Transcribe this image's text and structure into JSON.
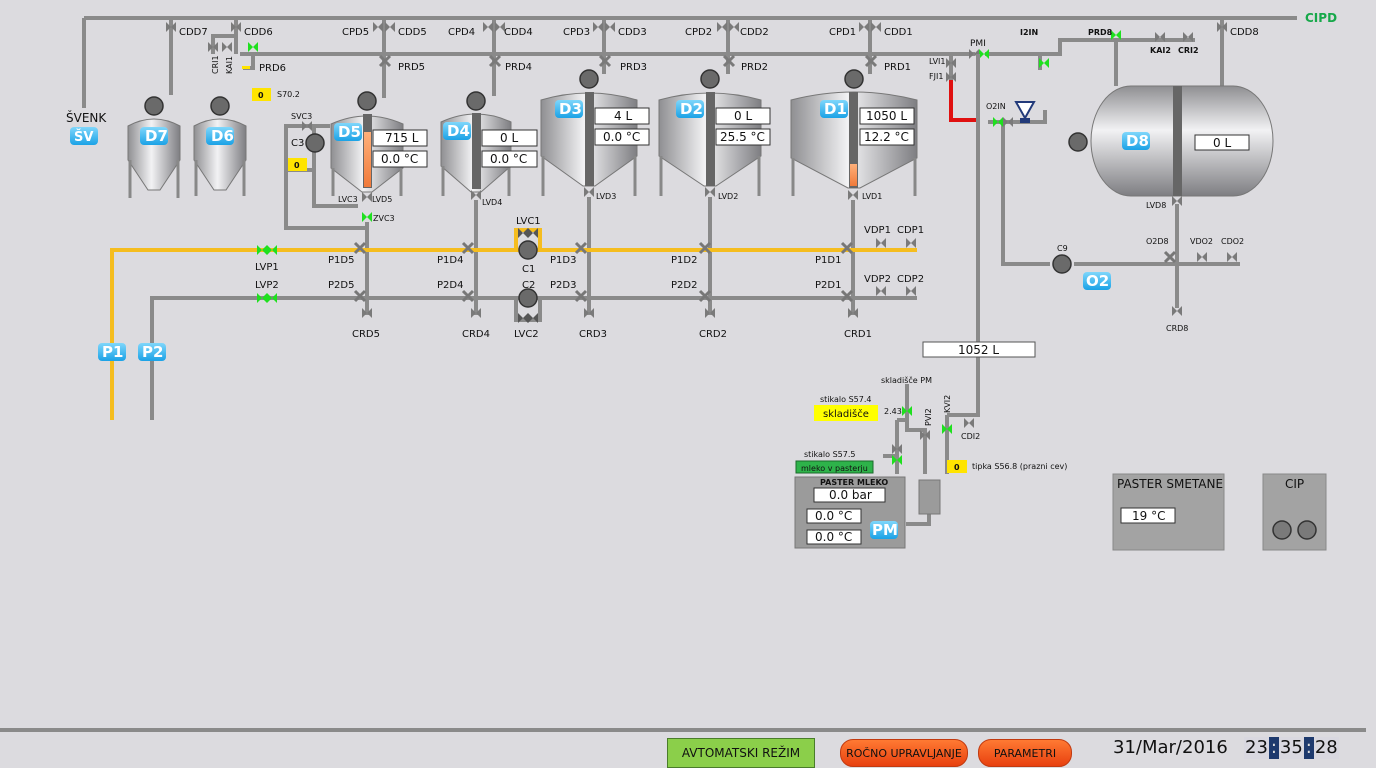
{
  "header": {
    "cipd": "CIPD"
  },
  "tanks": {
    "d7": {
      "tag": "D7",
      "valve_top": "CDD7"
    },
    "d6": {
      "tag": "D6",
      "valve_top": "CDD6"
    },
    "d5": {
      "tag": "D5",
      "volume": "715 L",
      "temp": "0.0 °C",
      "cpd": "CPD5",
      "cdd": "CDD5",
      "prd": "PRD5",
      "lvd": "LVD5"
    },
    "d4": {
      "tag": "D4",
      "volume": "0 L",
      "temp": "0.0 °C",
      "cpd": "CPD4",
      "cdd": "CDD4",
      "prd": "PRD4",
      "lvd": "LVD4"
    },
    "d3": {
      "tag": "D3",
      "volume": "4 L",
      "temp": "0.0 °C",
      "cpd": "CPD3",
      "cdd": "CDD3",
      "prd": "PRD3",
      "lvd": "LVD3"
    },
    "d2": {
      "tag": "D2",
      "volume": "0 L",
      "temp": "25.5 °C",
      "cpd": "CPD2",
      "cdd": "CDD2",
      "prd": "PRD2",
      "lvd": "LVD2"
    },
    "d1": {
      "tag": "D1",
      "volume": "1050 L",
      "temp": "12.2 °C",
      "cpd": "CPD1",
      "cdd": "CDD1",
      "prd": "PRD1",
      "lvd": "LVD1"
    },
    "d8": {
      "tag": "D8",
      "volume": "0 L",
      "lvd": "LVD8",
      "cdd": "CDD8",
      "prd": "PRD8"
    }
  },
  "labels": {
    "svenk": "ŠVENK",
    "sv": "ŠV",
    "cri1": "CRI1",
    "kai1": "KAI1",
    "prd6": "PRD6",
    "s702_val": "0",
    "s702": "S70.2",
    "svc3": "SVC3",
    "c3": "C3",
    "c3_val": "0",
    "lvc3": "LVC3",
    "zvc3": "ZVC3",
    "pmi": "PMI",
    "lvi1": "LVI1",
    "fji1": "FJI1",
    "i2in": "I2IN",
    "o2in": "O2IN",
    "kai2": "KAI2",
    "cri2": "CRI2",
    "lvp1": "LVP1",
    "lvp2": "LVP2",
    "p1": "P1",
    "p2": "P2",
    "lvc1": "LVC1",
    "lvc2": "LVC2",
    "c1": "C1",
    "c2": "C2",
    "p1d5": "P1D5",
    "p2d5": "P2D5",
    "crd5": "CRD5",
    "p1d4": "P1D4",
    "p2d4": "P2D4",
    "crd4": "CRD4",
    "p1d3": "P1D3",
    "p2d3": "P2D3",
    "crd3": "CRD3",
    "p1d2": "P1D2",
    "p2d2": "P2D2",
    "crd2": "CRD2",
    "p1d1": "P1D1",
    "p2d1": "P2D1",
    "crd1": "CRD1",
    "vdp1": "VDP1",
    "cdp1": "CDP1",
    "vdp2": "VDP2",
    "cdp2": "CDP2",
    "c9": "C9",
    "o2": "O2",
    "o2d8": "O2D8",
    "vdo2": "VDO2",
    "cdo2": "CDO2",
    "crd8": "CRD8",
    "flow_total": "1052 L"
  },
  "paster_mleko": {
    "title": "PASTER MLEKO",
    "tag": "PM",
    "pressure": "0.0 bar",
    "temp1": "0.0 °C",
    "temp2": "0.0 °C",
    "skladisce_pm": "skladišče PM",
    "stikalo_574": "stikalo S57.4",
    "skladisce_btn": "skladišče",
    "val_243": "2.43",
    "pvi2": "PVI2",
    "kvi2": "KVI2",
    "cdi2": "CDI2",
    "stikalo_575": "stikalo S57.5",
    "mleko_btn": "mleko v pasterju",
    "tipka_val": "0",
    "tipka": "tipka S56.8 (prazni cev)"
  },
  "paster_smetane": {
    "title": "PASTER SMETANE",
    "temp": "19 °C"
  },
  "cip": {
    "title": "CIP"
  },
  "footer": {
    "auto_label": "AVTOMATSKI REŽIM",
    "manual_label": "ROČNO UPRAVLJANJE",
    "param_label": "PARAMETRI",
    "date": "31/Mar/2016",
    "hh": "23",
    "mm": "35",
    "ss": "28"
  },
  "colors": {
    "pipe": "#8a8a8a",
    "yellow_pipe": "#f5bd1f",
    "tag_blue": "#29b3f0",
    "valve_open": "#1fe01f",
    "red_line": "#e01010"
  }
}
